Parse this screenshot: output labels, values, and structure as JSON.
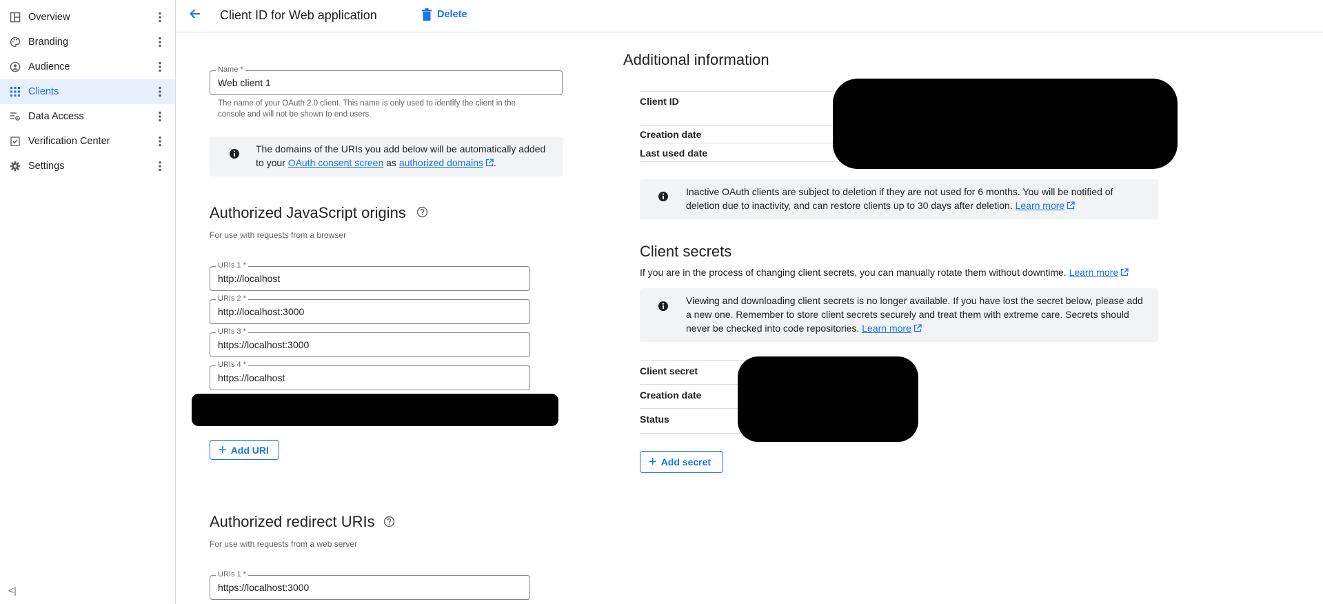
{
  "sidebar": {
    "items": [
      {
        "label": "Overview",
        "icon": "dashboard-icon"
      },
      {
        "label": "Branding",
        "icon": "palette-icon"
      },
      {
        "label": "Audience",
        "icon": "account-circle-icon"
      },
      {
        "label": "Clients",
        "icon": "apps-grid-icon",
        "active": true
      },
      {
        "label": "Data Access",
        "icon": "data-settings-icon"
      },
      {
        "label": "Verification Center",
        "icon": "checkbox-icon"
      },
      {
        "label": "Settings",
        "icon": "gear-icon"
      }
    ],
    "collapse_glyph": "<|"
  },
  "header": {
    "title": "Client ID for Web application",
    "delete_label": "Delete"
  },
  "form": {
    "name": {
      "label": "Name *",
      "value": "Web client 1",
      "hint_line1": "The name of your OAuth 2.0 client. This name is only used to identify the client in the",
      "hint_line2": "console and will not be shown to end users."
    },
    "domains_info": {
      "text1": "The domains of the URIs you add below will be automatically added",
      "text2a": "to your ",
      "link1": "OAuth consent screen",
      "text2b": " as ",
      "link2": "authorized domains",
      "text2c": "."
    },
    "js_origins": {
      "title": "Authorized JavaScript origins",
      "subtitle": "For use with requests from a browser",
      "uris": [
        {
          "label": "URIs 1 *",
          "value": "http://localhost"
        },
        {
          "label": "URIs 2 *",
          "value": "http://localhost:3000"
        },
        {
          "label": "URIs 3 *",
          "value": "https://localhost:3000"
        },
        {
          "label": "URIs 4 *",
          "value": "https://localhost"
        }
      ],
      "add_label": "Add URI"
    },
    "redirect_uris": {
      "title": "Authorized redirect URIs",
      "subtitle": "For use with requests from a web server",
      "uris": [
        {
          "label": "URIs 1 *",
          "value": "https://localhost:3000"
        }
      ]
    }
  },
  "additional": {
    "title": "Additional information",
    "rows": [
      "Client ID",
      "Creation date",
      "Last used date"
    ],
    "inactive_info": {
      "line1": "Inactive OAuth clients are subject to deletion if they are not used for 6 months. You will be notified of",
      "line2": "deletion due to inactivity, and can restore clients up to 30 days after deletion. ",
      "link": "Learn more"
    }
  },
  "secrets": {
    "title": "Client secrets",
    "desc": "If you are in the process of changing client secrets, you can manually rotate them without downtime. ",
    "desc_link": "Learn more",
    "info": {
      "line1": "Viewing and downloading client secrets is no longer available. If you have lost the secret below, please add",
      "line2": "a new one. Remember to store client secrets securely and treat them with extreme care. Secrets should",
      "line3": "never be checked into code repositories. ",
      "link": "Learn more"
    },
    "rows": [
      "Client secret",
      "Creation date",
      "Status"
    ],
    "add_label": "Add secret"
  },
  "colors": {
    "accent": "#1a73e8",
    "active_bg": "#e8f0fe",
    "info_bg": "#f1f3f4",
    "redaction": "#000000"
  }
}
